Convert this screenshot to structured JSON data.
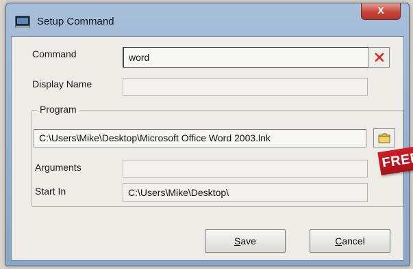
{
  "window": {
    "title": "Setup Command",
    "close_label": "X"
  },
  "form": {
    "command_label": "Command",
    "command_value": "word",
    "display_name_label": "Display Name",
    "display_name_value": "",
    "program_group_label": "Program",
    "program_path_value": "C:\\Users\\Mike\\Desktop\\Microsoft Office Word 2003.lnk",
    "arguments_label": "Arguments",
    "arguments_value": "",
    "start_in_label": "Start In",
    "start_in_value": "C:\\Users\\Mike\\Desktop\\"
  },
  "buttons": {
    "save_prefix": "S",
    "save_rest": "ave",
    "cancel_prefix": "C",
    "cancel_rest": "ancel"
  },
  "overlay": {
    "ribbon_text": "FREE"
  },
  "icons": {
    "title": "window-icon",
    "clear": "red-x-icon",
    "browse": "folder-icon"
  },
  "colors": {
    "clear_icon": "#d42a1e",
    "folder_icon": "#e4c04a",
    "ribbon": "#c41a22"
  }
}
